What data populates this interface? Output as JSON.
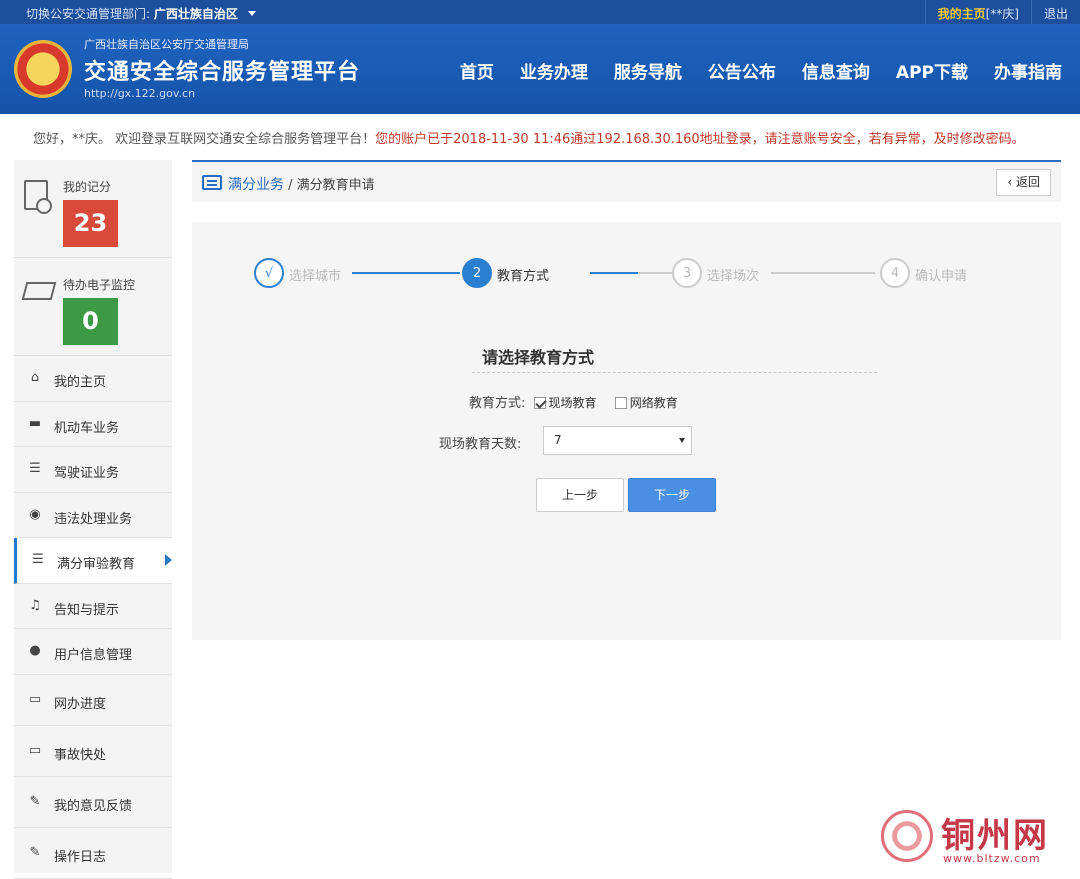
{
  "topbar": {
    "switch_prefix": "切换公安交通管理部门:",
    "switch_region": "广西壮族自治区",
    "my_home": "我的主页",
    "user_masked": "[**庆]",
    "logout": "退出"
  },
  "header": {
    "org": "广西壮族自治区公安厅交通管理局",
    "title": "交通安全综合服务管理平台",
    "url": "http://gx.122.gov.cn",
    "nav": [
      "首页",
      "业务办理",
      "服务导航",
      "公告公布",
      "信息查询",
      "APP下载",
      "办事指南"
    ]
  },
  "welcome": {
    "greeting": "您好，**庆。 欢迎登录互联网交通安全综合服务管理平台！",
    "warning": "您的账户已于2018-11-30 11:46通过192.168.30.160地址登录，请注意账号安全，若有异常，及时修改密码。"
  },
  "sidebar": {
    "score_label": "我的记分",
    "score_value": "23",
    "pending_label": "待办电子监控",
    "pending_value": "0",
    "items": [
      {
        "label": "我的主页",
        "icon": "home-icon"
      },
      {
        "label": "机动车业务",
        "icon": "truck-icon"
      },
      {
        "label": "驾驶证业务",
        "icon": "license-card-icon"
      },
      {
        "label": "违法处理业务",
        "icon": "camera-icon"
      },
      {
        "label": "满分审验教育",
        "icon": "list-card-icon"
      },
      {
        "label": "告知与提示",
        "icon": "bell-icon"
      },
      {
        "label": "用户信息管理",
        "icon": "user-icon"
      },
      {
        "label": "网办进度",
        "icon": "progress-icon"
      },
      {
        "label": "事故快处",
        "icon": "accident-icon"
      },
      {
        "label": "我的意见反馈",
        "icon": "feedback-icon"
      },
      {
        "label": "操作日志",
        "icon": "log-icon"
      }
    ]
  },
  "breadcrumb": {
    "section": "满分业务",
    "separator": " / ",
    "current": "满分教育申请",
    "back": "返回"
  },
  "steps": [
    {
      "num": "√",
      "label": "选择城市",
      "state": "done"
    },
    {
      "num": "2",
      "label": "教育方式",
      "state": "current"
    },
    {
      "num": "3",
      "label": "选择场次",
      "state": "todo"
    },
    {
      "num": "4",
      "label": "确认申请",
      "state": "todo"
    }
  ],
  "form": {
    "title": "请选择教育方式",
    "method_label": "教育方式:",
    "option_onsite": "现场教育",
    "option_online": "网络教育",
    "days_label": "现场教育天数:",
    "days_value": "7",
    "prev": "上一步",
    "next": "下一步"
  },
  "watermark": {
    "name": "铜州网",
    "url": "www.bltzw.com"
  },
  "colors": {
    "brand_blue": "#1d4f9c",
    "accent": "#2a7fd0",
    "score_red": "#d94a3b",
    "pending_green": "#3c9a44"
  }
}
